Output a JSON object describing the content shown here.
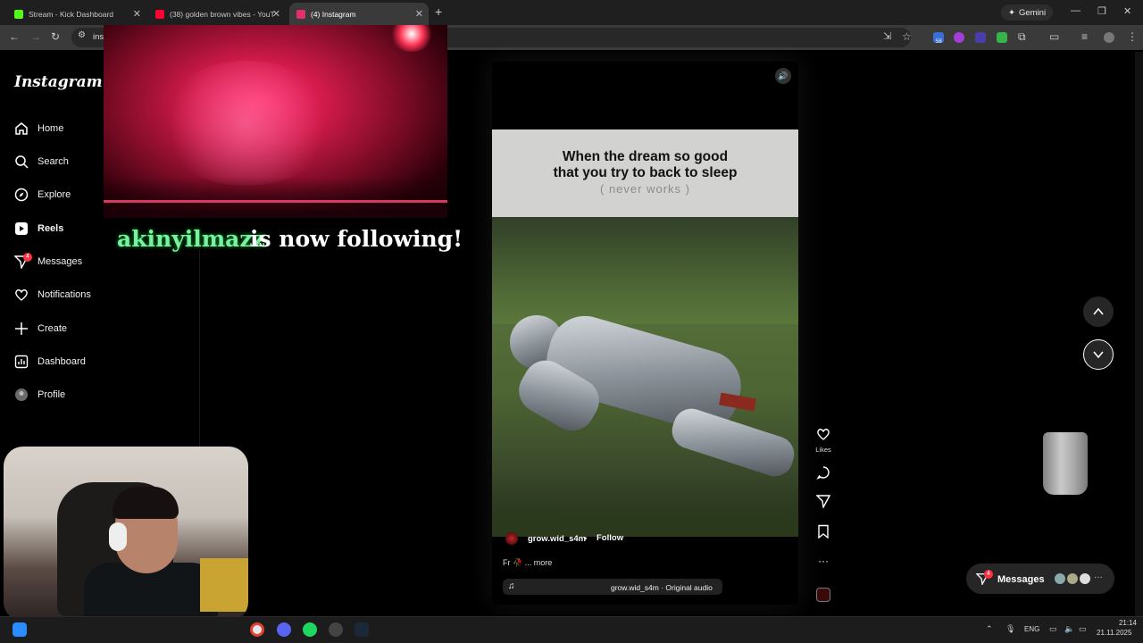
{
  "browser": {
    "tabs": [
      {
        "title": "Stream - Kick Dashboard",
        "favicon_color": "#53fc18",
        "active": false
      },
      {
        "title": "(38) golden brown vibes - YouT",
        "favicon_color": "#ff0033",
        "active": false
      },
      {
        "title": "(4) Instagram",
        "favicon_color": "#e1306c",
        "active": true
      }
    ],
    "new_tab_symbol": "+",
    "gemini_label": "Gemini",
    "address_fragment": "ins",
    "ext_badge": "58"
  },
  "overlay": {
    "follower_name": "akinyilmazz",
    "follow_message": "is now following!"
  },
  "instagram": {
    "logo": "Instagram",
    "nav": [
      {
        "label": "Home",
        "icon": "home-icon"
      },
      {
        "label": "Search",
        "icon": "search-icon"
      },
      {
        "label": "Explore",
        "icon": "compass-icon"
      },
      {
        "label": "Reels",
        "icon": "reels-icon",
        "active": true
      },
      {
        "label": "Messages",
        "icon": "messenger-icon",
        "badge": "4"
      },
      {
        "label": "Notifications",
        "icon": "heart-icon"
      },
      {
        "label": "Create",
        "icon": "plus-icon"
      },
      {
        "label": "Dashboard",
        "icon": "dashboard-icon"
      },
      {
        "label": "Profile",
        "icon": "avatar-icon"
      }
    ],
    "reel": {
      "caption_line1": "When the dream so good",
      "caption_line2": "that you try to back to sleep",
      "caption_sub": "( never works )",
      "username": "grow.wid_s4m",
      "separator": "•",
      "follow_label": "Follow",
      "description": "Fr 🥀 ... more",
      "audio": "grow.wid_s4m · Original audio",
      "likes_label": "Likes"
    },
    "messages_pill": {
      "label": "Messages",
      "badge": "4"
    }
  },
  "taskbar": {
    "lang": "ENG",
    "time": "21:14",
    "date": "21.11.2025"
  },
  "colors": {
    "accent_badge": "#ff3040",
    "follower_green": "#7af0a0"
  }
}
